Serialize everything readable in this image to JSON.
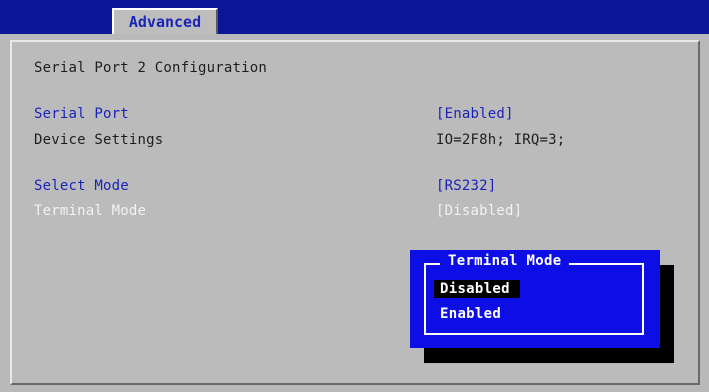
{
  "tabs": [
    {
      "label": "Advanced",
      "active": true
    }
  ],
  "page": {
    "title": "Serial Port 2 Configuration",
    "rows": [
      {
        "label": "Serial Port",
        "value": "[Enabled]"
      },
      {
        "label": "Device Settings",
        "value": "IO=2F8h; IRQ=3;"
      },
      {
        "label": "Select Mode",
        "value": "[RS232]"
      },
      {
        "label": "Terminal Mode",
        "value": "[Disabled]"
      }
    ]
  },
  "popup": {
    "title": "Terminal Mode",
    "options": [
      "Disabled",
      "Enabled"
    ],
    "selected_option": "Disabled"
  },
  "colors": {
    "top_bar": "#0b1597",
    "panel_bg": "#bbbbbb",
    "accent_text": "#1a24b8",
    "popup_bg": "#0d0ee6",
    "highlight_text": "#f2f2f2"
  }
}
